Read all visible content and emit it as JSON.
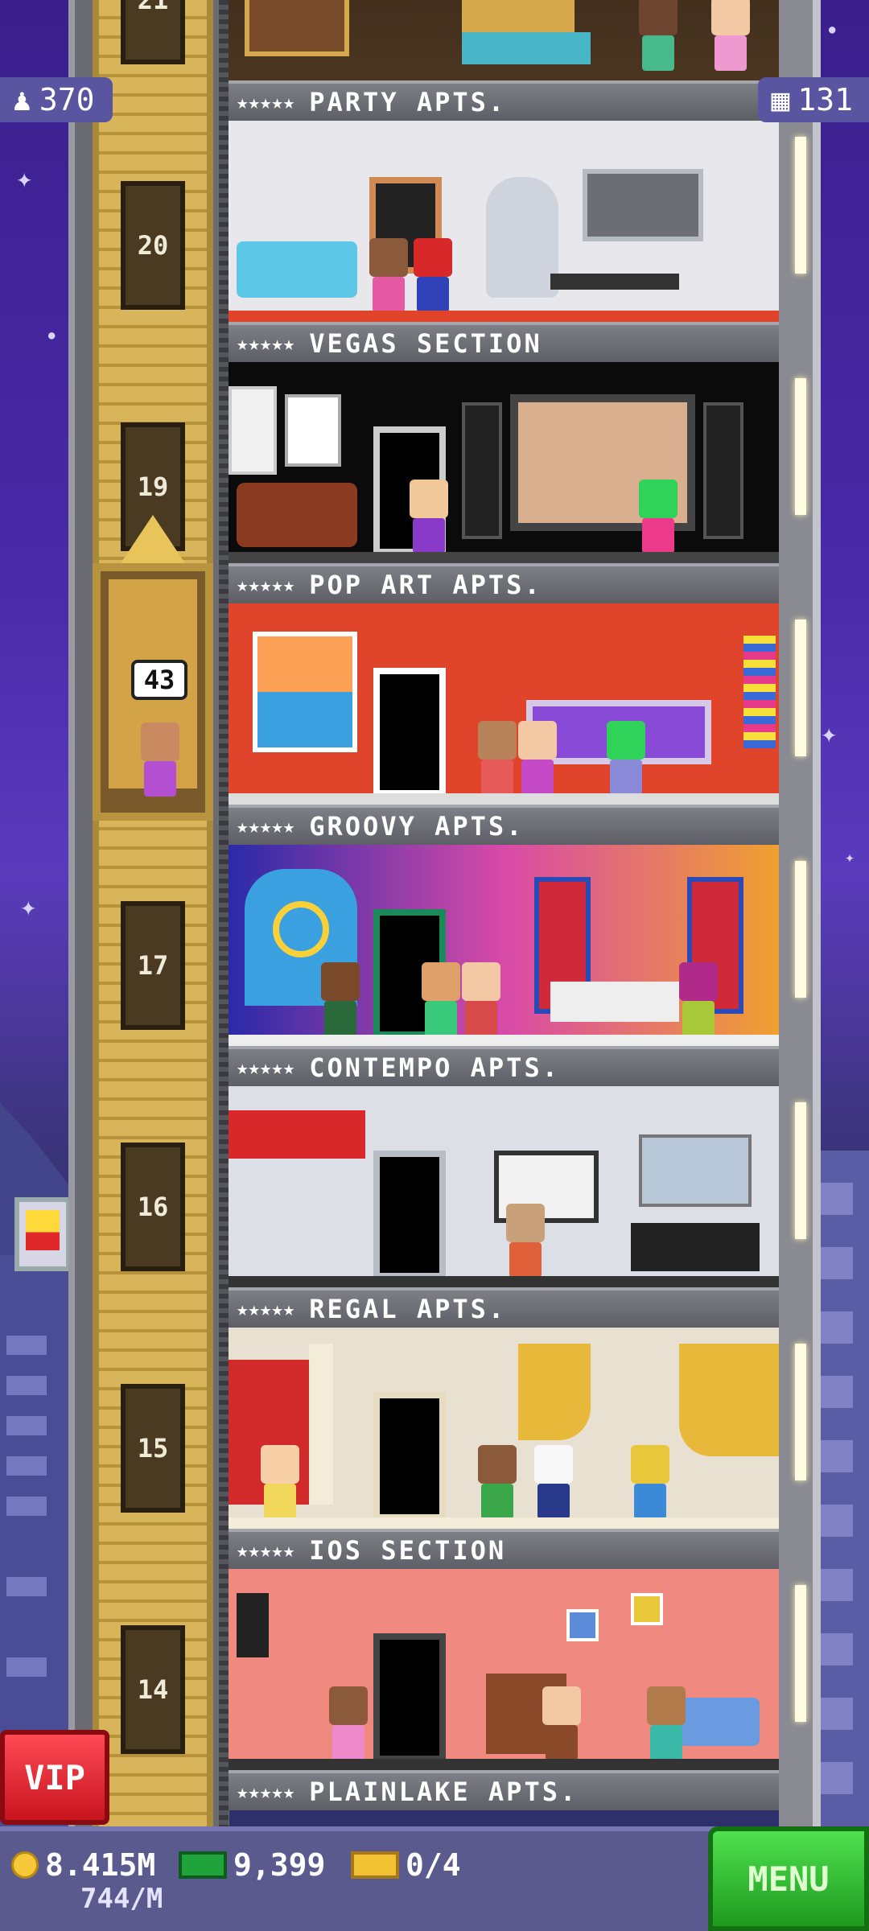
{
  "hud": {
    "population": "370",
    "floor_count": "131",
    "coins": "8.415M",
    "coins_per_min": "744/M",
    "tower_bux": "9,399",
    "tickets": "0/4",
    "menu_label": "MENU",
    "vip_label": "VIP"
  },
  "shaft_numbers": [
    "21",
    "20",
    "19",
    "17",
    "16",
    "15",
    "14"
  ],
  "elevator": {
    "bubble": "43"
  },
  "floors": [
    {
      "name": "PARTY APTS.",
      "stars": "★★★★★"
    },
    {
      "name": "VEGAS SECTION",
      "stars": "★★★★★"
    },
    {
      "name": "POP ART APTS.",
      "stars": "★★★★★"
    },
    {
      "name": "GROOVY APTS.",
      "stars": "★★★★★"
    },
    {
      "name": "CONTEMPO APTS.",
      "stars": "★★★★★"
    },
    {
      "name": "REGAL APTS.",
      "stars": "★★★★★"
    },
    {
      "name": "IOS SECTION",
      "stars": "★★★★★"
    },
    {
      "name": "PLAINLAKE APTS.",
      "stars": "★★★★★"
    }
  ],
  "colors": {
    "sky": "#4a2aa8",
    "menu_green": "#2fbf2f",
    "vip_red": "#e0202c",
    "hud_panel": "#5a55a0"
  },
  "icons": [
    "person-icon",
    "building-icon",
    "coin-icon",
    "bux-icon",
    "ticket-icon",
    "star-icon"
  ]
}
